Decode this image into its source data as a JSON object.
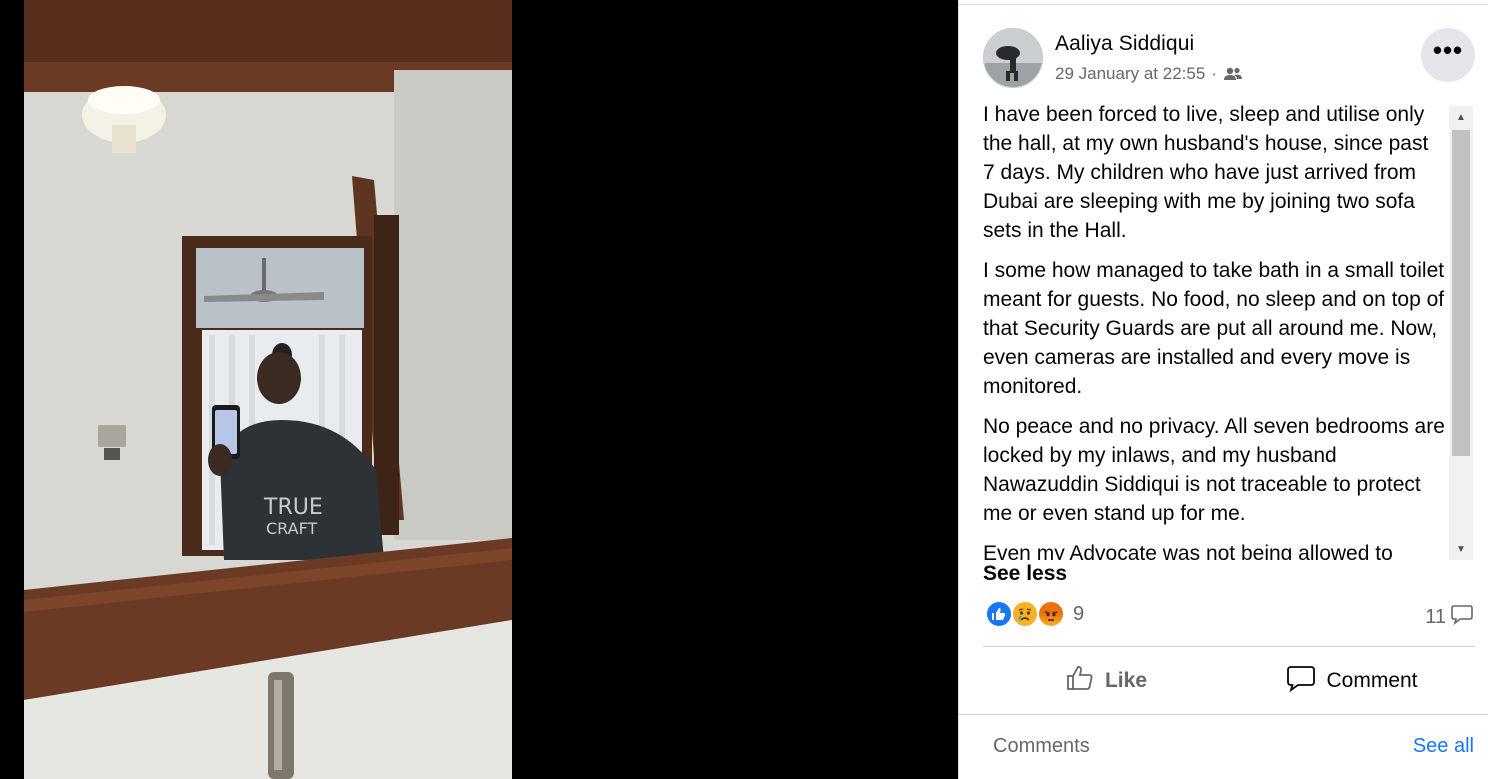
{
  "post": {
    "author": "Aaliya Siddiqui",
    "timestamp": "29 January at 22:55",
    "separator": "·",
    "audience_icon": "friends-icon",
    "more_label": "•••",
    "paragraphs": [
      "I have been forced to live, sleep and utilise only the hall, at my own husband's house, since past 7 days. My children who have just arrived from Dubai are sleeping with me by joining two sofa sets in the Hall.",
      "I some how managed to take bath in a small toilet meant for guests. No food, no sleep and on top of that Security Guards are put all around me. Now, even cameras are installed and every move is monitored.",
      "No peace and no privacy. All seven bedrooms are locked by my inlaws, and my husband Nawazuddin Siddiqui is not traceable to protect me or even stand up for me.",
      "Even my Advocate was not being allowed to"
    ],
    "see_less": "See less",
    "reactions": {
      "types": [
        "like",
        "sad",
        "angry"
      ],
      "count": "9"
    },
    "comment_count": "11",
    "actions": {
      "like": "Like",
      "comment": "Comment"
    },
    "comments_section": {
      "label": "Comments",
      "see_all": "See all"
    }
  },
  "photo": {
    "shirt_text_line1": "TRUE",
    "shirt_text_line2": "CRAFT"
  },
  "colors": {
    "background": "#000000",
    "panel": "#ffffff",
    "link": "#1877f2",
    "secondary_text": "#65676b",
    "primary_text": "#050505"
  }
}
